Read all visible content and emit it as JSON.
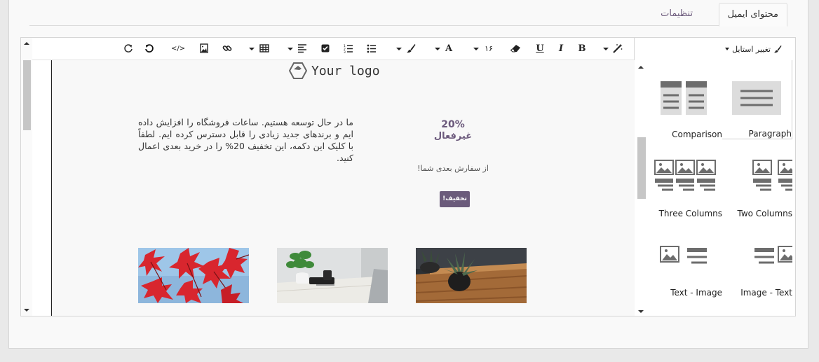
{
  "tabs": [
    {
      "label": "محتوای ایمیل",
      "active": true
    },
    {
      "label": "تنظیمات",
      "active": false
    }
  ],
  "toolbar": {
    "buttons": [
      {
        "name": "redo-icon"
      },
      {
        "name": "undo-icon"
      },
      {
        "name": "code-view-icon",
        "label": "</>"
      },
      {
        "name": "insert-image-icon"
      },
      {
        "name": "insert-link-icon"
      },
      {
        "name": "table-icon"
      },
      {
        "name": "align-icon"
      },
      {
        "name": "checklist-icon"
      },
      {
        "name": "ordered-list-icon"
      },
      {
        "name": "unordered-list-icon"
      },
      {
        "name": "paint-brush-icon"
      },
      {
        "name": "font-color-icon",
        "label": "A"
      },
      {
        "name": "font-size-select",
        "label": "۱۶"
      },
      {
        "name": "eraser-icon"
      },
      {
        "name": "underline-icon",
        "label": "U"
      },
      {
        "name": "italic-icon",
        "label": "I"
      },
      {
        "name": "bold-icon",
        "label": "B"
      },
      {
        "name": "magic-wand-icon"
      }
    ]
  },
  "canvas": {
    "logo_text": "Your logo",
    "body_text": "ما در حال توسعه هستیم. ساعات فروشگاه را افزایش داده ایم و برندهای جدید زیادی را قابل دسترس کرده ایم. لطفاً با کلیک این دکمه، این تخفیف 20% را در خرید بعدی اعمال کنید.",
    "promo_percent": "20%",
    "promo_label": "غیرفعال",
    "promo_sub": "از سفارش بعدی شما!",
    "promo_button": "تخفیف!",
    "accent_color": "#6b5b7b"
  },
  "sidebar": {
    "style_dropdown": "تغییر استایل",
    "snippets": [
      {
        "label": "Paragraph",
        "icon": "paragraph-icon",
        "selected": true
      },
      {
        "label": "Comparison",
        "icon": "comparison-icon",
        "selected": false
      },
      {
        "label": "Two Columns",
        "icon": "two-columns-icon",
        "selected": false
      },
      {
        "label": "Three Columns",
        "icon": "three-columns-icon",
        "selected": false
      },
      {
        "label": "Image - Text",
        "icon": "image-text-icon",
        "selected": false
      },
      {
        "label": "Text - Image",
        "icon": "text-image-icon",
        "selected": false
      }
    ]
  }
}
